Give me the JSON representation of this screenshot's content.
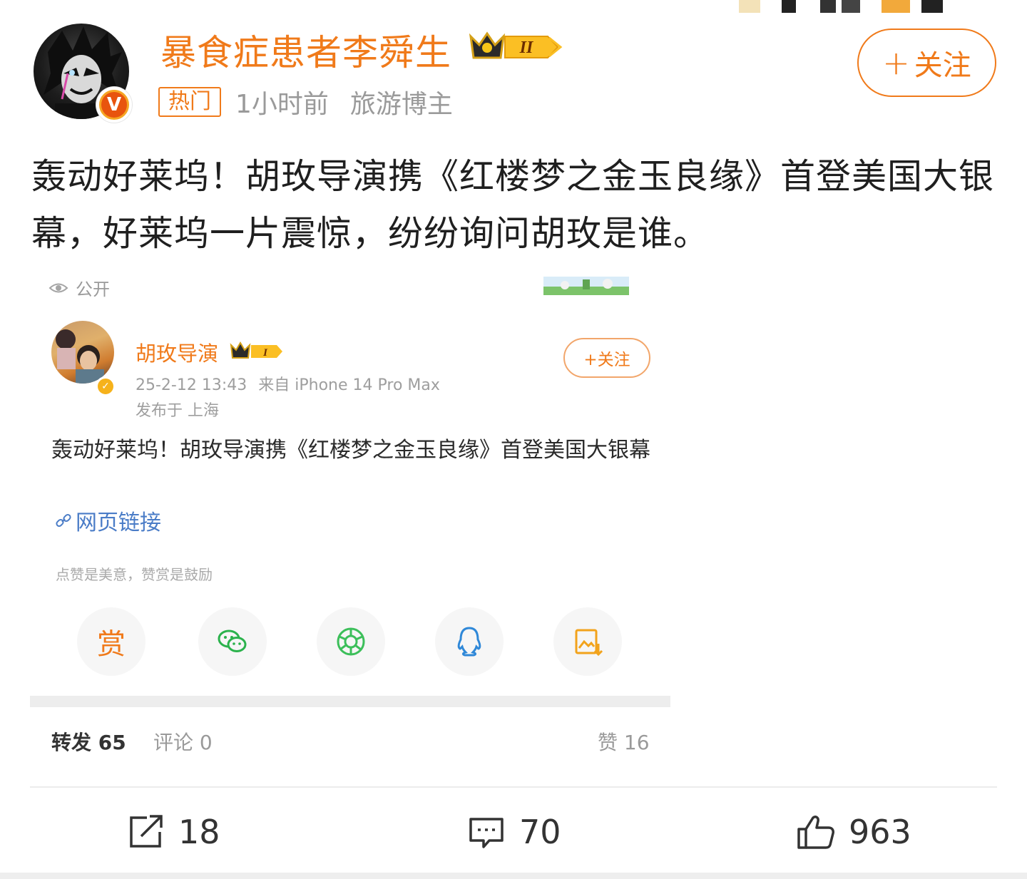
{
  "colors": {
    "accent": "#f07a1a",
    "meta_gray": "#9a9a9a",
    "link_blue": "#4a7cc7"
  },
  "post": {
    "author": {
      "name": "暴食症患者李舜生",
      "verified_mark": "V",
      "level_badge": "II",
      "tag_hot": "热门",
      "time": "1小时前",
      "role": "旅游博主"
    },
    "follow_plus": "+",
    "follow_label": "关注",
    "text": "轰动好莱坞！胡玫导演携《红楼梦之金玉良缘》首登美国大银幕，好莱坞一片震惊，纷纷询问胡玫是谁。",
    "embedded": {
      "visibility": "公开",
      "author_name": "胡玫导演",
      "level_badge": "I",
      "datetime": "25-2-12 13:43",
      "source": "来自 iPhone 14 Pro Max",
      "location": "发布于 上海",
      "follow_label": "+关注",
      "text": "轰动好莱坞！胡玫导演携《红楼梦之金玉良缘》首登美国大银幕",
      "link_label": "网页链接",
      "reward_tip": "点赞是美意，赞赏是鼓励",
      "reward_char": "赏",
      "share_icons": [
        "reward-icon",
        "wechat-icon",
        "moments-icon",
        "qq-icon",
        "save-image-icon"
      ],
      "stats": {
        "repost": "转发 65",
        "comment": "评论 0",
        "like": "赞 16"
      }
    },
    "actions": {
      "forward": "18",
      "comment": "70",
      "like": "963"
    }
  }
}
